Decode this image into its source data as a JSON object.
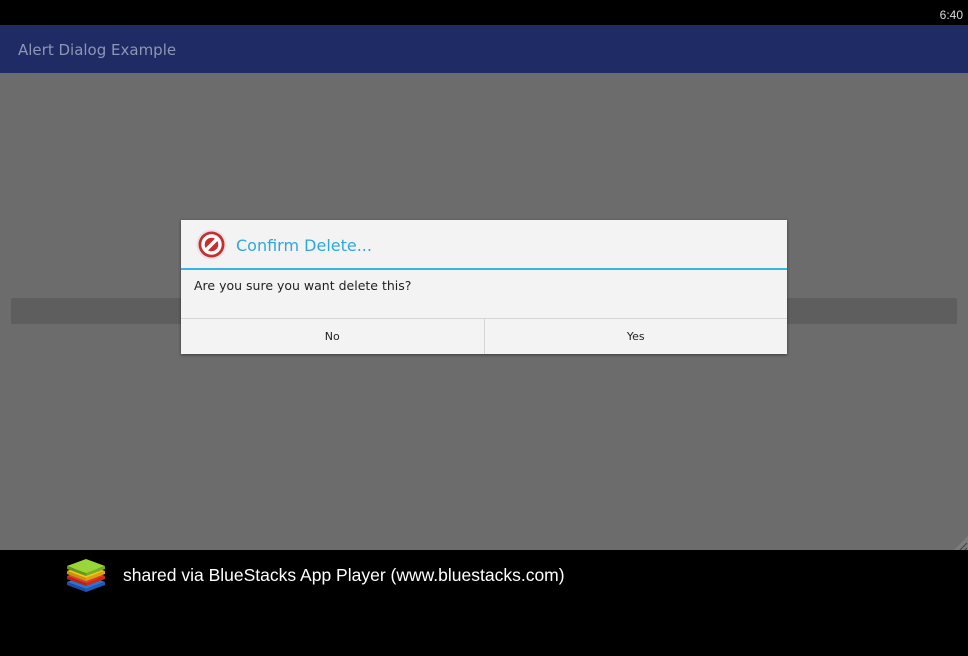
{
  "status_bar": {
    "time": "6:40"
  },
  "app_bar": {
    "title": "Alert Dialog Example"
  },
  "dialog": {
    "icon": "stop-icon",
    "title": "Confirm Delete...",
    "message": "Are you sure you want delete this?",
    "negative_label": "No",
    "positive_label": "Yes",
    "accent_color": "#33b5e5"
  },
  "footer": {
    "logo": "bluestacks-logo-icon",
    "text": "shared via BlueStacks App Player (www.bluestacks.com)"
  },
  "colors": {
    "app_bar": "#1f2b64",
    "scrim": "#6c6c6c",
    "dialog_background": "#f3f3f3"
  }
}
